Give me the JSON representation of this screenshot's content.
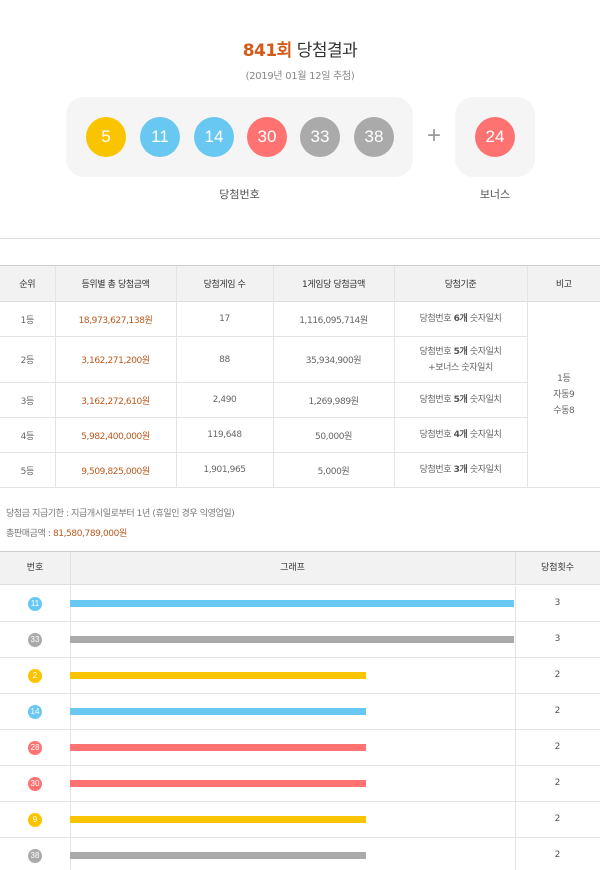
{
  "header": {
    "round": "841회",
    "title_suffix": "당첨결과",
    "date": "(2019년 01월 12일 추첨)"
  },
  "draw": {
    "numbers": [
      {
        "n": "5",
        "color": "#fbc400"
      },
      {
        "n": "11",
        "color": "#69c8f2"
      },
      {
        "n": "14",
        "color": "#69c8f2"
      },
      {
        "n": "30",
        "color": "#ff7272"
      },
      {
        "n": "33",
        "color": "#aaaaaa"
      },
      {
        "n": "38",
        "color": "#aaaaaa"
      }
    ],
    "plus": "+",
    "bonus": {
      "n": "24",
      "color": "#ff7272"
    },
    "label_winning": "당첨번호",
    "label_bonus": "보너스"
  },
  "prize_table": {
    "headers": [
      "순위",
      "등위별 총 당첨금액",
      "당첨게임 수",
      "1게임당 당첨금액",
      "당첨기준",
      "비고"
    ],
    "rows": [
      {
        "rank": "1등",
        "total": "18,973,627,138원",
        "games": "17",
        "per": "1,116,095,714원",
        "crit_pre": "당첨번호 ",
        "crit_bold": "6개",
        "crit_post": " 숫자일치",
        "crit_extra": ""
      },
      {
        "rank": "2등",
        "total": "3,162,271,200원",
        "games": "88",
        "per": "35,934,900원",
        "crit_pre": "당첨번호 ",
        "crit_bold": "5개",
        "crit_post": " 숫자일치",
        "crit_extra": "+보너스 숫자일치"
      },
      {
        "rank": "3등",
        "total": "3,162,272,610원",
        "games": "2,490",
        "per": "1,269,989원",
        "crit_pre": "당첨번호 ",
        "crit_bold": "5개",
        "crit_post": " 숫자일치",
        "crit_extra": ""
      },
      {
        "rank": "4등",
        "total": "5,982,400,000원",
        "games": "119,648",
        "per": "50,000원",
        "crit_pre": "당첨번호 ",
        "crit_bold": "4개",
        "crit_post": " 숫자일치",
        "crit_extra": ""
      },
      {
        "rank": "5등",
        "total": "9,509,825,000원",
        "games": "1,901,965",
        "per": "5,000원",
        "crit_pre": "당첨번호 ",
        "crit_bold": "3개",
        "crit_post": " 숫자일치",
        "crit_extra": ""
      }
    ],
    "note_lines": [
      "1등",
      "자동9",
      "수동8"
    ]
  },
  "info": {
    "claim_period": "당첨금 지급기한 : 지급개시일로부터 1년 (휴일인 경우 익영업일)",
    "total_sales_label": "총판매금액 : ",
    "total_sales_value": "81,580,789,000원"
  },
  "stats": {
    "headers": [
      "번호",
      "그래프",
      "당첨횟수"
    ],
    "max_count": 3,
    "rows": [
      {
        "num": "11",
        "color": "#69c8f2",
        "count": 3
      },
      {
        "num": "33",
        "color": "#aaaaaa",
        "count": 3
      },
      {
        "num": "2",
        "color": "#fbc400",
        "count": 2
      },
      {
        "num": "14",
        "color": "#69c8f2",
        "count": 2
      },
      {
        "num": "28",
        "color": "#ff7272",
        "count": 2
      },
      {
        "num": "30",
        "color": "#ff7272",
        "count": 2
      },
      {
        "num": "9",
        "color": "#fbc400",
        "count": 2
      },
      {
        "num": "38",
        "color": "#aaaaaa",
        "count": 2
      }
    ]
  }
}
